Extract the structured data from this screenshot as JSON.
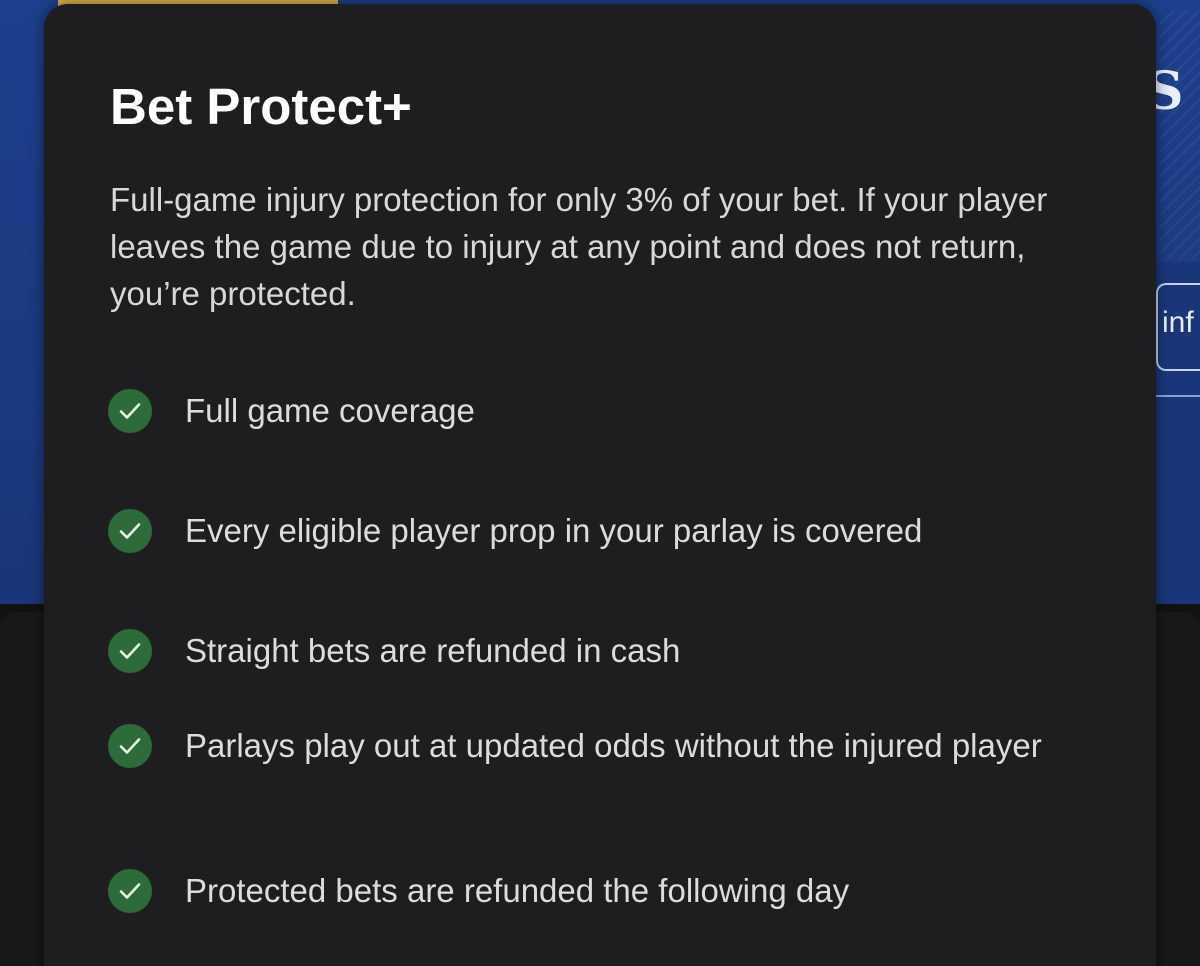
{
  "background": {
    "side_text": "inf",
    "colors": {
      "hero_blue": "#1d3f8c",
      "dark": "#121213"
    }
  },
  "modal": {
    "title": "Bet Protect+",
    "description": "Full-game injury protection for only 3% of your bet. If your player leaves the game due to injury at any point and does not return, you’re protected.",
    "features": [
      {
        "icon": "check-circle-icon",
        "label": "Full game coverage"
      },
      {
        "icon": "check-circle-icon",
        "label": "Every eligible player prop in your parlay is covered"
      },
      {
        "icon": "check-circle-icon",
        "label": "Straight bets are refunded in cash"
      },
      {
        "icon": "check-circle-icon",
        "label": "Parlays play out at updated odds without the injured player"
      },
      {
        "icon": "check-circle-icon",
        "label": "Protected bets are refunded the following day"
      }
    ],
    "colors": {
      "background": "#1e1e20",
      "check_green": "#2d6b3a",
      "text": "#dcdcde"
    }
  }
}
